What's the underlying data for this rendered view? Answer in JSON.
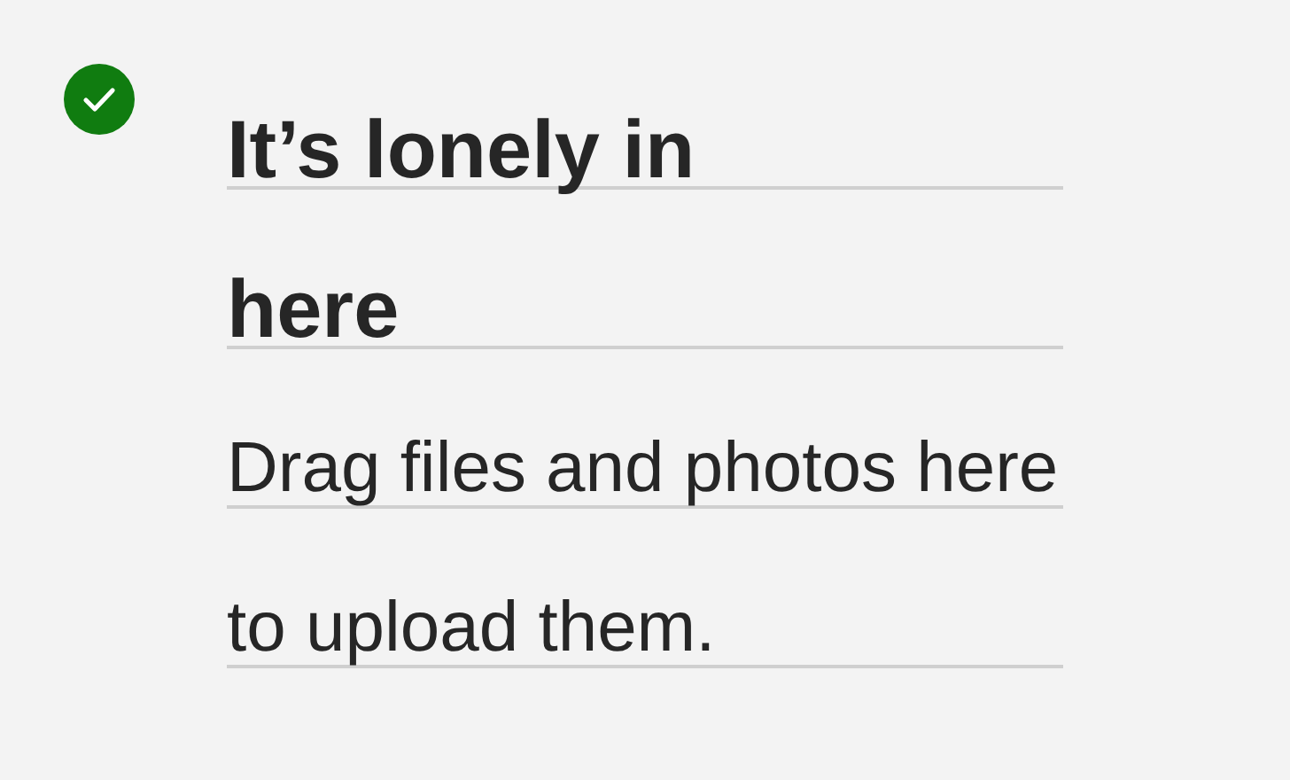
{
  "status_icon": {
    "kind": "success"
  },
  "title": "It’s lonely in here",
  "message": "Drag files and photos here to upload them."
}
